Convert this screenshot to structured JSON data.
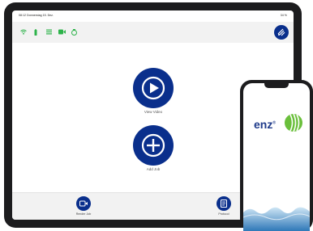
{
  "statusbar": {
    "time_date": "08:12  Donnerstag 15. Dez.",
    "battery": "34 %"
  },
  "toolbar_icons": [
    "wifi-icon",
    "battery-icon",
    "list-icon",
    "video-icon",
    "fuel-icon"
  ],
  "main": {
    "view_video": {
      "label": "View Video",
      "icon": "play-icon"
    },
    "add_job": {
      "label": "Add Job",
      "icon": "plus-icon"
    }
  },
  "bottombar": {
    "render_job": {
      "label": "Render Job",
      "icon": "video-edit-icon"
    },
    "protocol": {
      "label": "Protocol",
      "icon": "document-icon"
    }
  },
  "phone": {
    "logo_text": "enz",
    "logo_mark": "®"
  },
  "colors": {
    "brand_blue": "#0a2f8c",
    "status_green": "#2db34a",
    "logo_green": "#6abf3b"
  }
}
